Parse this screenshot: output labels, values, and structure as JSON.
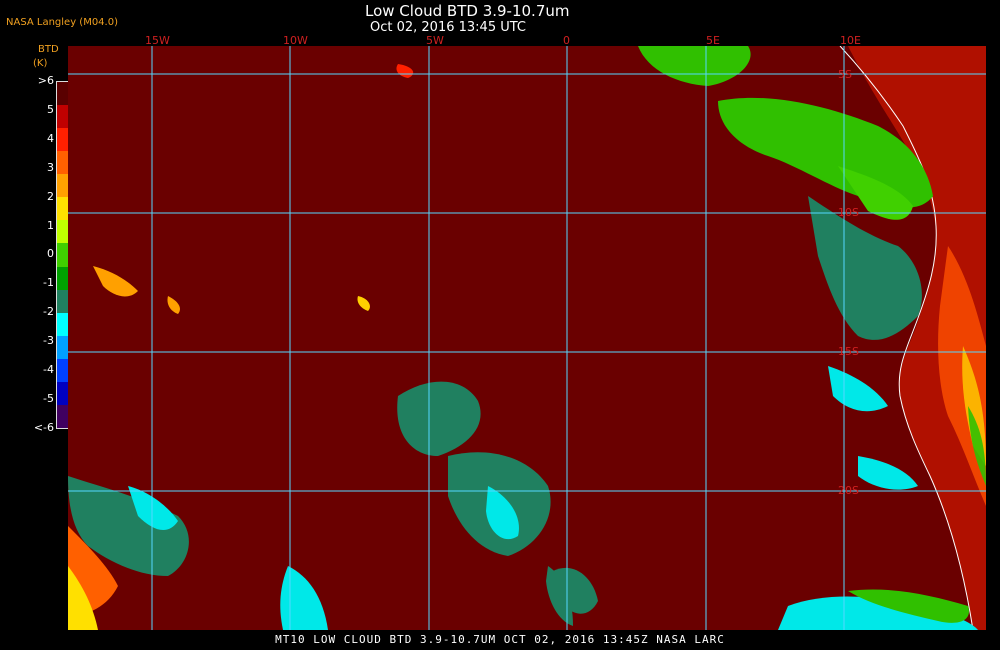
{
  "header": {
    "title": "Low Cloud BTD 3.9-10.7um",
    "subtitle": "Oct 02, 2016 13:45 UTC",
    "source": "NASA Langley (M04.0)"
  },
  "colorbar": {
    "label": "BTD",
    "unit": "(K)",
    "ticks": [
      ">6",
      "5",
      "4",
      "3",
      "2",
      "1",
      "0",
      "-1",
      "-2",
      "-3",
      "-4",
      "-5",
      "<-6"
    ],
    "colors": [
      "#5a0000",
      "#c00000",
      "#ff2000",
      "#ff6000",
      "#ffa000",
      "#ffe000",
      "#c0ff00",
      "#40d000",
      "#00a000",
      "#208060",
      "#00ffff",
      "#00a0ff",
      "#0040ff",
      "#0000c0",
      "#400060"
    ]
  },
  "map": {
    "lon_labels": [
      "15W",
      "10W",
      "5W",
      "0",
      "5E",
      "10E"
    ],
    "lat_labels": [
      "5S",
      "10S",
      "15S",
      "20S"
    ]
  },
  "footer": {
    "text": "MT10  LOW CLOUD BTD 3.9-10.7UM   OCT 02, 2016 13:45Z   NASA LARC"
  }
}
